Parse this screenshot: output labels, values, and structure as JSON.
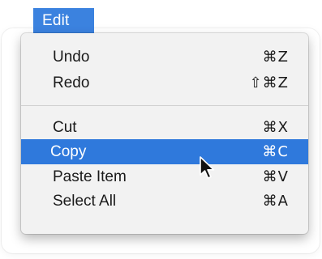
{
  "menu": {
    "title": "Edit",
    "items": [
      {
        "label": "Undo",
        "shortcut": "⌘Z"
      },
      {
        "label": "Redo",
        "shortcut": "⇧⌘Z"
      },
      {
        "label": "Cut",
        "shortcut": "⌘X"
      },
      {
        "label": "Copy",
        "shortcut": "⌘C",
        "selected": true
      },
      {
        "label": "Paste Item",
        "shortcut": "⌘V"
      },
      {
        "label": "Select All",
        "shortcut": "⌘A"
      }
    ]
  },
  "colors": {
    "highlight": "#2f79dc",
    "title_bg": "#3b82df",
    "menu_bg": "#f2f2f2"
  },
  "icons": {
    "cursor": "arrow-cursor-icon"
  }
}
